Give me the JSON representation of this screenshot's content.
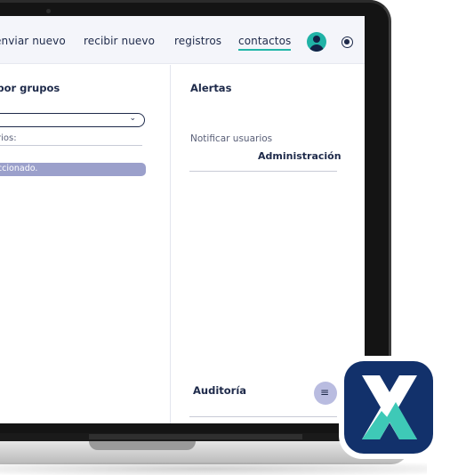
{
  "nav": {
    "items": [
      {
        "label": "enviar nuevo"
      },
      {
        "label": "recibir nuevo"
      },
      {
        "label": "registros"
      },
      {
        "label": "contactos",
        "active": true
      }
    ],
    "avatar_icon": "user-avatar-icon",
    "settings_icon": "radio-settings-icon"
  },
  "left_panel": {
    "title": "Filtrar por grupos",
    "select_label": "Usuarios:",
    "select_value": "",
    "status_message": "Ningún grupo seleccionado."
  },
  "right_panel": {
    "alerts_title": "Alertas",
    "notify_label": "Notificar usuarios",
    "notify_value": "Administración",
    "audit_title": "Auditoría",
    "notes_icon": "notes-lines-icon"
  },
  "colors": {
    "accent": "#21b6a8",
    "navy": "#1e2a4a",
    "pill": "#9ba0cb",
    "badge_bg": "#12316b"
  }
}
